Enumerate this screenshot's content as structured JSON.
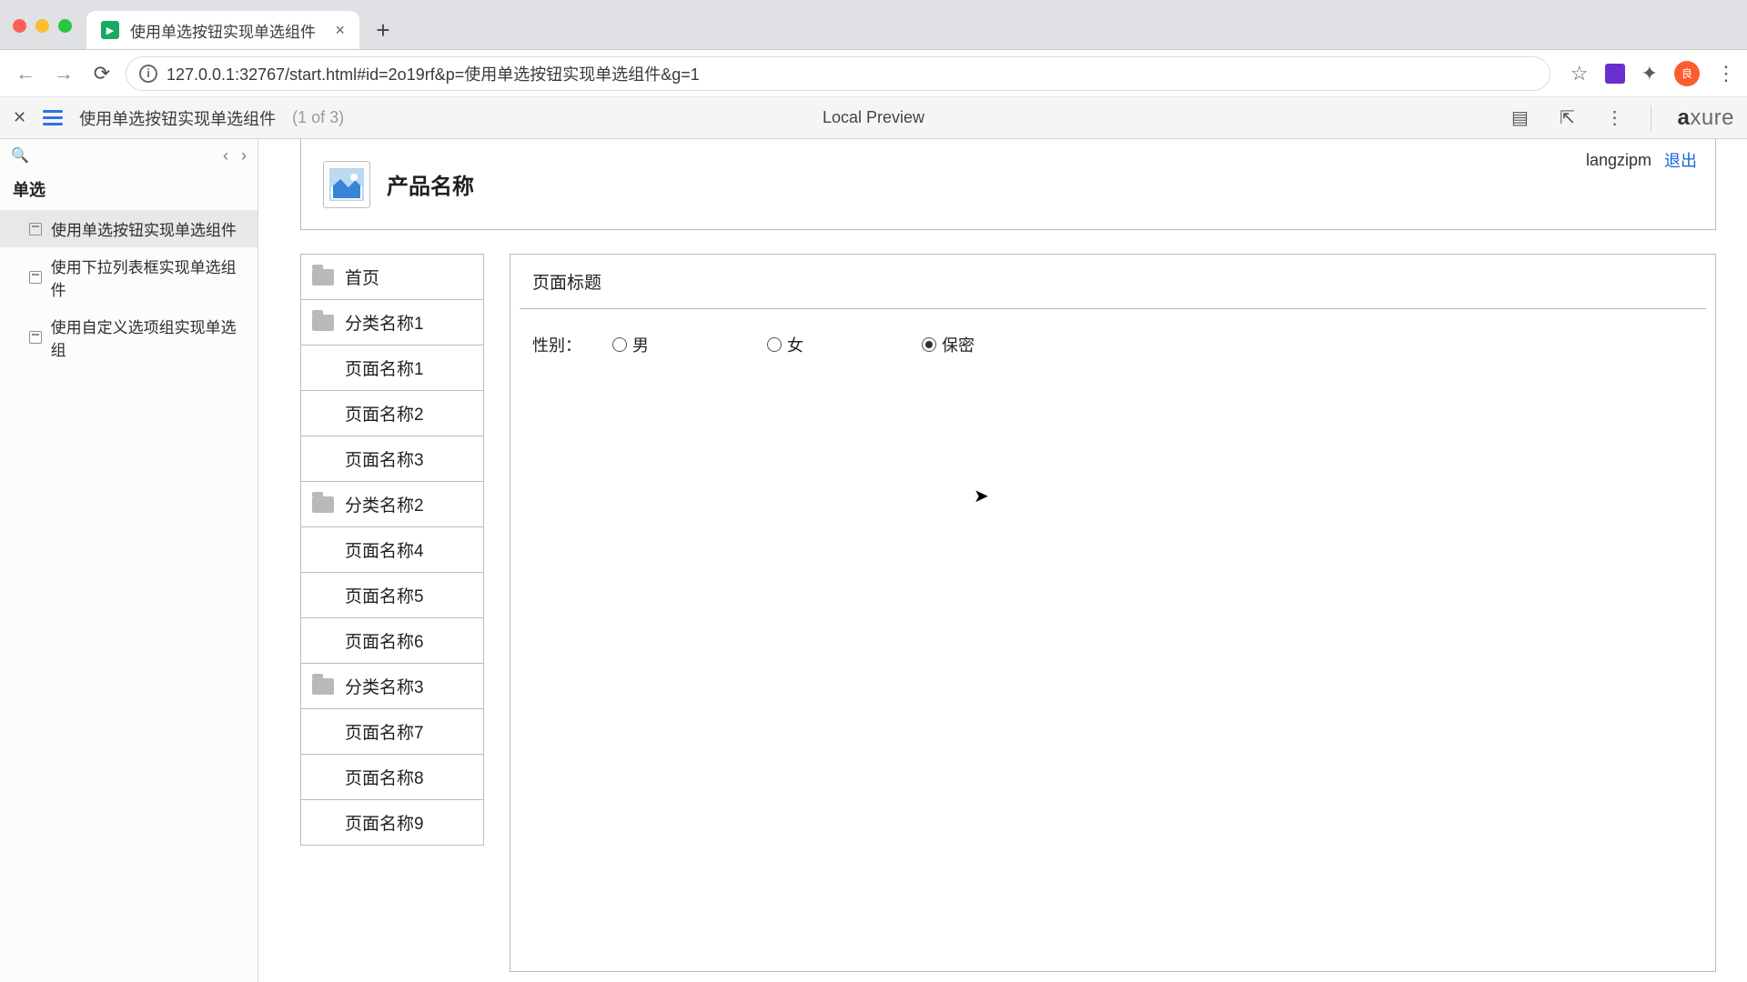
{
  "browser": {
    "tab_title": "使用单选按钮实现单选组件",
    "url": "127.0.0.1:32767/start.html#id=2o19rf&p=使用单选按钮实现单选组件&g=1"
  },
  "axure_toolbar": {
    "page_name": "使用单选按钮实现单选组件",
    "counter": "(1 of 3)",
    "center_label": "Local Preview",
    "logo": "axure"
  },
  "pages_panel": {
    "section_title": "单选",
    "items": [
      {
        "label": "使用单选按钮实现单选组件",
        "active": true
      },
      {
        "label": "使用下拉列表框实现单选组件",
        "active": false
      },
      {
        "label": "使用自定义选项组实现单选组",
        "active": false
      }
    ]
  },
  "prototype": {
    "product_name": "产品名称",
    "username": "langzipm",
    "logout": "退出",
    "nav": [
      {
        "label": "首页",
        "level": 1
      },
      {
        "label": "分类名称1",
        "level": 1
      },
      {
        "label": "页面名称1",
        "level": 2
      },
      {
        "label": "页面名称2",
        "level": 2
      },
      {
        "label": "页面名称3",
        "level": 2
      },
      {
        "label": "分类名称2",
        "level": 1
      },
      {
        "label": "页面名称4",
        "level": 2
      },
      {
        "label": "页面名称5",
        "level": 2
      },
      {
        "label": "页面名称6",
        "level": 2
      },
      {
        "label": "分类名称3",
        "level": 1
      },
      {
        "label": "页面名称7",
        "level": 2
      },
      {
        "label": "页面名称8",
        "level": 2
      },
      {
        "label": "页面名称9",
        "level": 2
      }
    ],
    "content_title": "页面标题",
    "form": {
      "label": "性别：",
      "options": [
        {
          "label": "男",
          "checked": false
        },
        {
          "label": "女",
          "checked": false
        },
        {
          "label": "保密",
          "checked": true
        }
      ]
    }
  }
}
